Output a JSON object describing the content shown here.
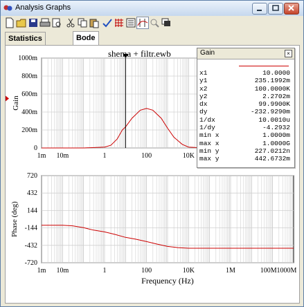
{
  "window": {
    "title": "Analysis Graphs"
  },
  "tabs": [
    {
      "label": "Statistics [Analog]"
    },
    {
      "label": "Bode"
    }
  ],
  "plot": {
    "title": "shema + filtr.ewb",
    "gain_ylabel": "Gain",
    "phase_ylabel": "Phase (deg)",
    "xlabel": "Frequency (Hz)",
    "gain_yticks": [
      "1000m",
      "800m",
      "600m",
      "400m",
      "200m",
      "0"
    ],
    "phase_yticks": [
      "720",
      "432",
      "144",
      "-144",
      "-432",
      "-720"
    ],
    "gain_xticks": [
      "1m",
      "10m",
      "1",
      "100",
      "10K"
    ],
    "phase_xticks": [
      "1m",
      "10m",
      "1",
      "100",
      "10K",
      "1M",
      "100M",
      "1000M"
    ]
  },
  "gain_panel": {
    "title": "Gain",
    "rows": [
      {
        "k": "x1",
        "v": "10.0000"
      },
      {
        "k": "y1",
        "v": "235.1992m"
      },
      {
        "k": "x2",
        "v": "100.0000K"
      },
      {
        "k": "y2",
        "v": "2.2702m"
      },
      {
        "k": "dx",
        "v": "99.9900K"
      },
      {
        "k": "dy",
        "v": "-232.9290m"
      },
      {
        "k": "1/dx",
        "v": "10.0010u"
      },
      {
        "k": "1/dy",
        "v": "-4.2932"
      },
      {
        "k": "min x",
        "v": "1.0000m"
      },
      {
        "k": "max x",
        "v": "1.0000G"
      },
      {
        "k": "min y",
        "v": "227.0212n"
      },
      {
        "k": "max y",
        "v": "442.6732m"
      }
    ]
  },
  "chart_data": [
    {
      "type": "line",
      "title": "shema + filtr.ewb",
      "xlabel": "",
      "ylabel": "Gain",
      "xscale": "log",
      "xlim": [
        0.001,
        1000000000
      ],
      "ylim": [
        0,
        1
      ],
      "series": [
        {
          "values_x": [
            0.001,
            0.01,
            0.1,
            1,
            2,
            4,
            7,
            10,
            20,
            50,
            100,
            200,
            500,
            1000,
            2000,
            5000,
            10000,
            20000,
            100000
          ],
          "values_y": [
            0,
            0,
            0,
            0.01,
            0.03,
            0.1,
            0.2,
            0.235,
            0.33,
            0.42,
            0.44,
            0.42,
            0.33,
            0.22,
            0.12,
            0.04,
            0.01,
            0.005,
            0.0023
          ]
        }
      ]
    },
    {
      "type": "line",
      "xlabel": "Frequency (Hz)",
      "ylabel": "Phase (deg)",
      "xscale": "log",
      "xlim": [
        0.001,
        1000000000
      ],
      "ylim": [
        -720,
        720
      ],
      "series": [
        {
          "values_x": [
            0.001,
            0.01,
            0.03,
            0.1,
            0.3,
            1,
            3,
            10,
            30,
            100,
            300,
            1000,
            3000,
            10000,
            100000,
            1000000,
            100000000,
            1000000000
          ],
          "values_y": [
            -100,
            -100,
            -110,
            -140,
            -180,
            -210,
            -250,
            -300,
            -330,
            -370,
            -410,
            -450,
            -470,
            -480,
            -480,
            -480,
            -480,
            -480
          ]
        }
      ]
    }
  ],
  "colors": {
    "trace": "#cc0000",
    "cursor": "#000000",
    "grid": "#d0d0d0"
  }
}
